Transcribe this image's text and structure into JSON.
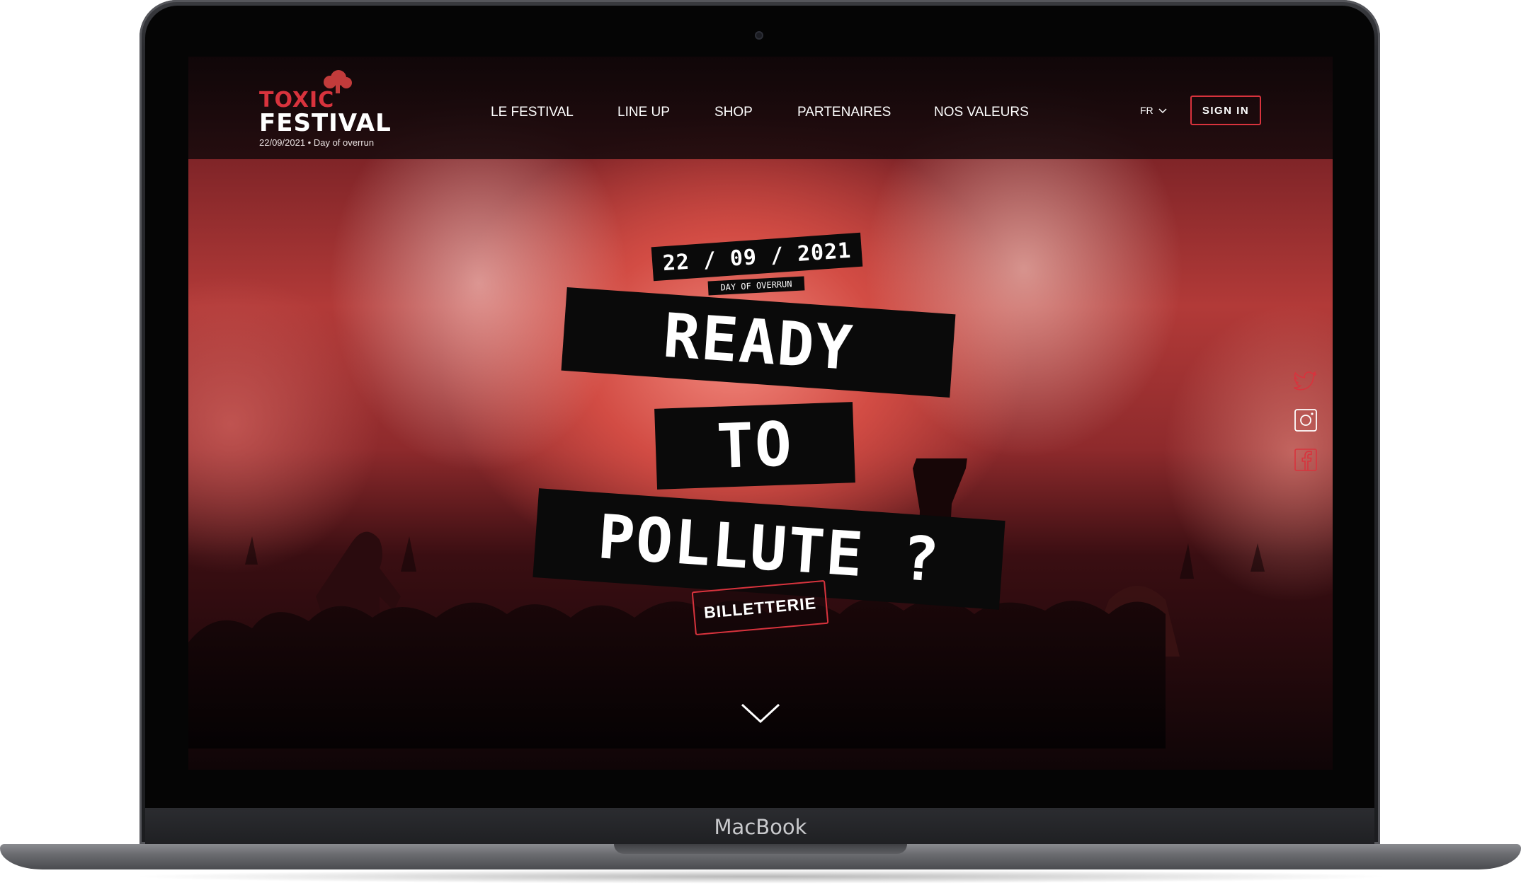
{
  "device": {
    "brand": "MacBook"
  },
  "logo": {
    "toxic": "TOXIC",
    "festival": "FESTIVAL",
    "subtitle": "22/09/2021 • Day of overrun"
  },
  "nav": [
    {
      "label": "LE FESTIVAL"
    },
    {
      "label": "LINE UP"
    },
    {
      "label": "SHOP"
    },
    {
      "label": "PARTENAIRES"
    },
    {
      "label": "NOS VALEURS"
    }
  ],
  "header": {
    "lang": "FR",
    "signin": "SIGN IN"
  },
  "hero": {
    "date": "22 / 09 / 2021",
    "day": "DAY OF OVERRUN",
    "line1": "READY",
    "line2": "TO",
    "line3": "POLLUTE ?",
    "cta": "BILLETTERIE"
  },
  "social": [
    "twitter-icon",
    "instagram-icon",
    "facebook-icon"
  ],
  "colors": {
    "accent": "#d8333d",
    "tape": "#0a0a0a",
    "text": "#ffffff"
  }
}
